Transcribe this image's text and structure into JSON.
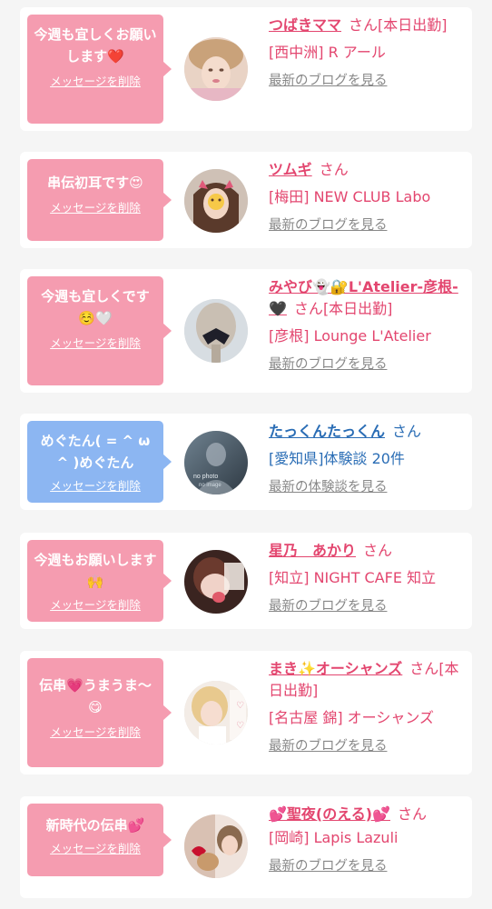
{
  "entries": [
    {
      "message": "今週も宜しくお願いします❤️",
      "delete_label": "メッセージを削除",
      "name": "つばきママ",
      "honorific": "さん",
      "status": "[本日出勤]",
      "shop": "[西中洲] R アール",
      "blog_link": "最新のブログを見る",
      "avatar_icon": "profile-photo",
      "bubble_color": "#f59cb0"
    },
    {
      "message": "串伝初耳です😍",
      "delete_label": "メッセージを削除",
      "name": "ツムギ",
      "honorific": "さん",
      "status": "",
      "shop": "[梅田] NEW CLUB Labo",
      "blog_link": "最新のブログを見る",
      "avatar_icon": "profile-photo",
      "bubble_color": "#f59cb0"
    },
    {
      "message": "今週も宜しくです☺️🤍",
      "delete_label": "メッセージを削除",
      "name": "みやび👻🔐L'Atelier-彦根-🖤",
      "honorific": "さん",
      "status": "[本日出勤]",
      "shop": "[彦根] Lounge L'Atelier",
      "blog_link": "最新のブログを見る",
      "avatar_icon": "profile-photo",
      "bubble_color": "#f59cb0"
    },
    {
      "message": "めぐたん( = ^ ω ^ )めぐたん",
      "delete_label": "メッセージを削除",
      "name": "たっくんたっくん",
      "honorific": "さん",
      "status": "",
      "shop": "[愛知県]体験談 20件",
      "blog_link": "最新の体験談を見る",
      "avatar_icon": "no-photo-avatar",
      "avatar_text_1": "no photo",
      "avatar_text_2": "no image",
      "bubble_color": "#8cb6f2"
    },
    {
      "message": "今週もお願いします🙌",
      "delete_label": "メッセージを削除",
      "name": "星乃　あかり",
      "honorific": "さん",
      "status": "",
      "shop": "[知立] NIGHT CAFE 知立",
      "blog_link": "最新のブログを見る",
      "avatar_icon": "profile-photo",
      "bubble_color": "#f59cb0"
    },
    {
      "message": "伝串💗うまうま〜😋",
      "delete_label": "メッセージを削除",
      "name": "まき✨オーシャンズ",
      "honorific": "さん",
      "status": "[本日出勤]",
      "shop": "[名古屋 錦] オーシャンズ",
      "blog_link": "最新のブログを見る",
      "avatar_icon": "profile-photo",
      "bubble_color": "#f59cb0"
    },
    {
      "message": "新時代の伝串💕",
      "delete_label": "メッセージを削除",
      "name": "💕聖夜(のえる)💕",
      "honorific": "さん",
      "status": "",
      "shop": "[岡崎] Lapis Lazuli",
      "blog_link": "最新のブログを見る",
      "avatar_icon": "profile-photo",
      "bubble_color": "#f59cb0"
    }
  ]
}
